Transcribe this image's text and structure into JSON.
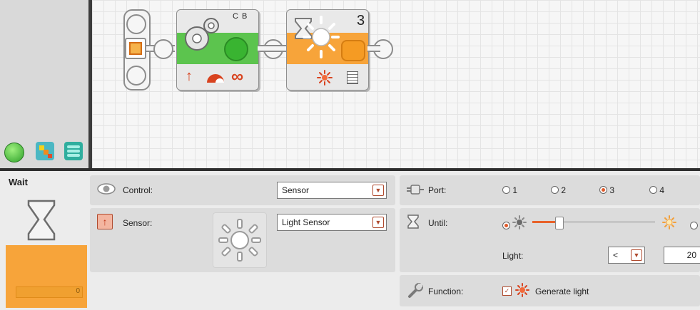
{
  "blocks": {
    "move": {
      "ports": "C B"
    },
    "wait": {
      "port_number": "3"
    }
  },
  "panel": {
    "block_title": "Wait",
    "block_counter": "0",
    "control": {
      "label": "Control:",
      "value": "Sensor"
    },
    "sensor": {
      "label": "Sensor:",
      "value": "Light Sensor"
    },
    "port": {
      "label": "Port:",
      "options": [
        "1",
        "2",
        "3",
        "4"
      ],
      "selected": "3"
    },
    "until": {
      "label": "Until:",
      "slider_fraction": 0.2
    },
    "light": {
      "label": "Light:",
      "comparison": "<",
      "value": "20"
    },
    "function": {
      "label": "Function:",
      "generate_light_label": "Generate light",
      "generate_light_checked": true
    }
  },
  "colors": {
    "accent_orange": "#f7a43a",
    "move_green": "#58c04a",
    "panel_bg": "#ececec"
  }
}
